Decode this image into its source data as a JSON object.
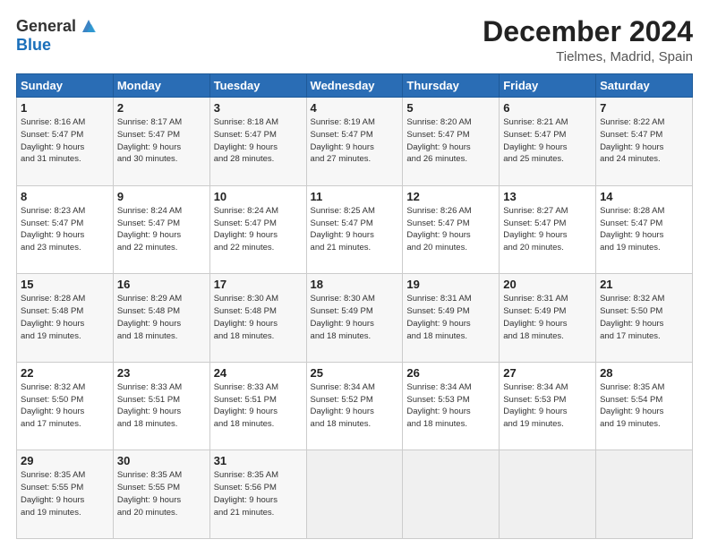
{
  "header": {
    "logo_general": "General",
    "logo_blue": "Blue",
    "month_title": "December 2024",
    "location": "Tielmes, Madrid, Spain"
  },
  "calendar": {
    "days_of_week": [
      "Sunday",
      "Monday",
      "Tuesday",
      "Wednesday",
      "Thursday",
      "Friday",
      "Saturday"
    ],
    "weeks": [
      [
        {
          "day": "1",
          "info": "Sunrise: 8:16 AM\nSunset: 5:47 PM\nDaylight: 9 hours\nand 31 minutes."
        },
        {
          "day": "2",
          "info": "Sunrise: 8:17 AM\nSunset: 5:47 PM\nDaylight: 9 hours\nand 30 minutes."
        },
        {
          "day": "3",
          "info": "Sunrise: 8:18 AM\nSunset: 5:47 PM\nDaylight: 9 hours\nand 28 minutes."
        },
        {
          "day": "4",
          "info": "Sunrise: 8:19 AM\nSunset: 5:47 PM\nDaylight: 9 hours\nand 27 minutes."
        },
        {
          "day": "5",
          "info": "Sunrise: 8:20 AM\nSunset: 5:47 PM\nDaylight: 9 hours\nand 26 minutes."
        },
        {
          "day": "6",
          "info": "Sunrise: 8:21 AM\nSunset: 5:47 PM\nDaylight: 9 hours\nand 25 minutes."
        },
        {
          "day": "7",
          "info": "Sunrise: 8:22 AM\nSunset: 5:47 PM\nDaylight: 9 hours\nand 24 minutes."
        }
      ],
      [
        {
          "day": "8",
          "info": "Sunrise: 8:23 AM\nSunset: 5:47 PM\nDaylight: 9 hours\nand 23 minutes."
        },
        {
          "day": "9",
          "info": "Sunrise: 8:24 AM\nSunset: 5:47 PM\nDaylight: 9 hours\nand 22 minutes."
        },
        {
          "day": "10",
          "info": "Sunrise: 8:24 AM\nSunset: 5:47 PM\nDaylight: 9 hours\nand 22 minutes."
        },
        {
          "day": "11",
          "info": "Sunrise: 8:25 AM\nSunset: 5:47 PM\nDaylight: 9 hours\nand 21 minutes."
        },
        {
          "day": "12",
          "info": "Sunrise: 8:26 AM\nSunset: 5:47 PM\nDaylight: 9 hours\nand 20 minutes."
        },
        {
          "day": "13",
          "info": "Sunrise: 8:27 AM\nSunset: 5:47 PM\nDaylight: 9 hours\nand 20 minutes."
        },
        {
          "day": "14",
          "info": "Sunrise: 8:28 AM\nSunset: 5:47 PM\nDaylight: 9 hours\nand 19 minutes."
        }
      ],
      [
        {
          "day": "15",
          "info": "Sunrise: 8:28 AM\nSunset: 5:48 PM\nDaylight: 9 hours\nand 19 minutes."
        },
        {
          "day": "16",
          "info": "Sunrise: 8:29 AM\nSunset: 5:48 PM\nDaylight: 9 hours\nand 18 minutes."
        },
        {
          "day": "17",
          "info": "Sunrise: 8:30 AM\nSunset: 5:48 PM\nDaylight: 9 hours\nand 18 minutes."
        },
        {
          "day": "18",
          "info": "Sunrise: 8:30 AM\nSunset: 5:49 PM\nDaylight: 9 hours\nand 18 minutes."
        },
        {
          "day": "19",
          "info": "Sunrise: 8:31 AM\nSunset: 5:49 PM\nDaylight: 9 hours\nand 18 minutes."
        },
        {
          "day": "20",
          "info": "Sunrise: 8:31 AM\nSunset: 5:49 PM\nDaylight: 9 hours\nand 18 minutes."
        },
        {
          "day": "21",
          "info": "Sunrise: 8:32 AM\nSunset: 5:50 PM\nDaylight: 9 hours\nand 17 minutes."
        }
      ],
      [
        {
          "day": "22",
          "info": "Sunrise: 8:32 AM\nSunset: 5:50 PM\nDaylight: 9 hours\nand 17 minutes."
        },
        {
          "day": "23",
          "info": "Sunrise: 8:33 AM\nSunset: 5:51 PM\nDaylight: 9 hours\nand 18 minutes."
        },
        {
          "day": "24",
          "info": "Sunrise: 8:33 AM\nSunset: 5:51 PM\nDaylight: 9 hours\nand 18 minutes."
        },
        {
          "day": "25",
          "info": "Sunrise: 8:34 AM\nSunset: 5:52 PM\nDaylight: 9 hours\nand 18 minutes."
        },
        {
          "day": "26",
          "info": "Sunrise: 8:34 AM\nSunset: 5:53 PM\nDaylight: 9 hours\nand 18 minutes."
        },
        {
          "day": "27",
          "info": "Sunrise: 8:34 AM\nSunset: 5:53 PM\nDaylight: 9 hours\nand 19 minutes."
        },
        {
          "day": "28",
          "info": "Sunrise: 8:35 AM\nSunset: 5:54 PM\nDaylight: 9 hours\nand 19 minutes."
        }
      ],
      [
        {
          "day": "29",
          "info": "Sunrise: 8:35 AM\nSunset: 5:55 PM\nDaylight: 9 hours\nand 19 minutes."
        },
        {
          "day": "30",
          "info": "Sunrise: 8:35 AM\nSunset: 5:55 PM\nDaylight: 9 hours\nand 20 minutes."
        },
        {
          "day": "31",
          "info": "Sunrise: 8:35 AM\nSunset: 5:56 PM\nDaylight: 9 hours\nand 21 minutes."
        },
        {
          "day": "",
          "info": ""
        },
        {
          "day": "",
          "info": ""
        },
        {
          "day": "",
          "info": ""
        },
        {
          "day": "",
          "info": ""
        }
      ]
    ]
  }
}
